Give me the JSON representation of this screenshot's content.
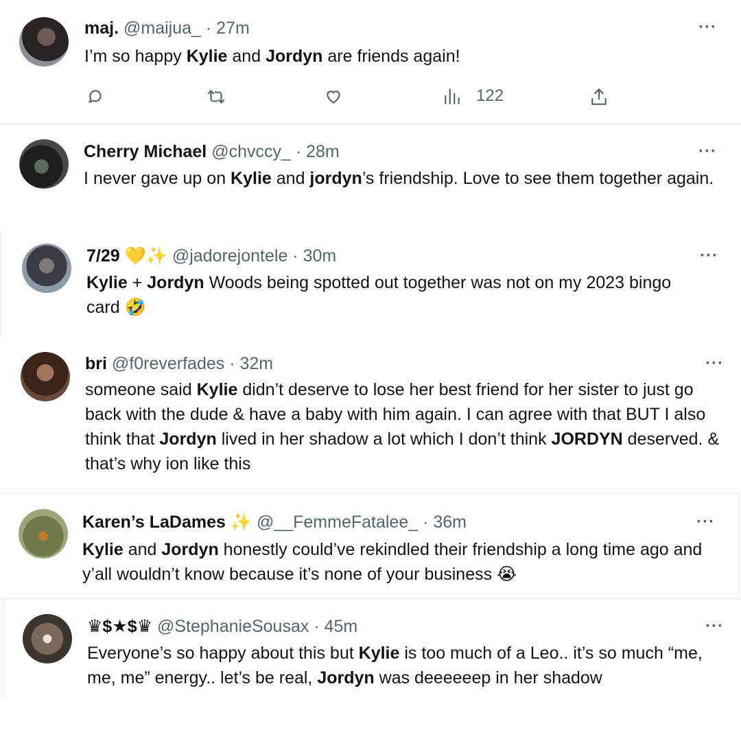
{
  "tweets": [
    {
      "name": "maj.",
      "handle": "@maijua_",
      "sep": " · ",
      "time": "27m",
      "more": "···",
      "text": [
        {
          "t": "I’m so happy ",
          "b": false
        },
        {
          "t": "Kylie",
          "b": true
        },
        {
          "t": " and ",
          "b": false
        },
        {
          "t": "Jordyn",
          "b": true
        },
        {
          "t": " are friends again!",
          "b": false
        }
      ],
      "views": "122"
    },
    {
      "name": "Cherry Michael",
      "handle": "@chvccy_",
      "sep": " · ",
      "time": "28m",
      "more": "···",
      "text": [
        {
          "t": "I never gave up on ",
          "b": false
        },
        {
          "t": "Kylie",
          "b": true
        },
        {
          "t": " and ",
          "b": false
        },
        {
          "t": "jordyn",
          "b": true
        },
        {
          "t": "’s friendship. Love to see them together again.",
          "b": false
        }
      ]
    },
    {
      "name": "7/29 💛✨",
      "handle": "@jadorejontele",
      "sep": " · ",
      "time": "30m",
      "more": "···",
      "text": [
        {
          "t": "Kylie",
          "b": true
        },
        {
          "t": " + ",
          "b": false
        },
        {
          "t": "Jordyn",
          "b": true
        },
        {
          "t": " Woods being spotted out together was not on my 2023 bingo card 🤣",
          "b": false
        }
      ]
    },
    {
      "name": "bri",
      "handle": "@f0reverfades",
      "sep": " · ",
      "time": "32m",
      "more": "···",
      "text": [
        {
          "t": "someone said ",
          "b": false
        },
        {
          "t": "Kylie",
          "b": true
        },
        {
          "t": " didn’t deserve to lose her best friend for her sister to just go back with the dude & have a baby with him again. I can agree with that BUT I also think that ",
          "b": false
        },
        {
          "t": "Jordyn",
          "b": true
        },
        {
          "t": " lived in her shadow a lot which I don’t think ",
          "b": false
        },
        {
          "t": "JORDYN",
          "b": true
        },
        {
          "t": " deserved. & that’s why ion like this",
          "b": false
        }
      ]
    },
    {
      "name": "Karen’s LaDames ✨",
      "handle": "@__FemmeFatalee_",
      "sep": " · ",
      "time": "36m",
      "more": "···",
      "text": [
        {
          "t": "Kylie",
          "b": true
        },
        {
          "t": " and ",
          "b": false
        },
        {
          "t": "Jordyn",
          "b": true
        },
        {
          "t": " honestly could’ve rekindled their friendship a long time ago and y’all wouldn’t know because it’s none of your business 😭",
          "b": false
        }
      ]
    },
    {
      "name": "♛$★$♛",
      "handle": "@StephanieSousax",
      "sep": " · ",
      "time": "45m",
      "more": "···",
      "text": [
        {
          "t": "Everyone’s so happy about this but ",
          "b": false
        },
        {
          "t": "Kylie",
          "b": true
        },
        {
          "t": " is too much of a Leo.. it’s so much “me, me, me” energy.. let’s be real, ",
          "b": false
        },
        {
          "t": "Jordyn",
          "b": true
        },
        {
          "t": " was deeeeeep in her shadow",
          "b": false
        }
      ]
    }
  ],
  "icons": {
    "reply": "reply-icon",
    "retweet": "retweet-icon",
    "like": "heart-icon",
    "views": "views-icon",
    "share": "share-icon"
  },
  "colors": {
    "text": "#0f1419",
    "muted": "#536471",
    "divider": "#e6ecf0"
  }
}
